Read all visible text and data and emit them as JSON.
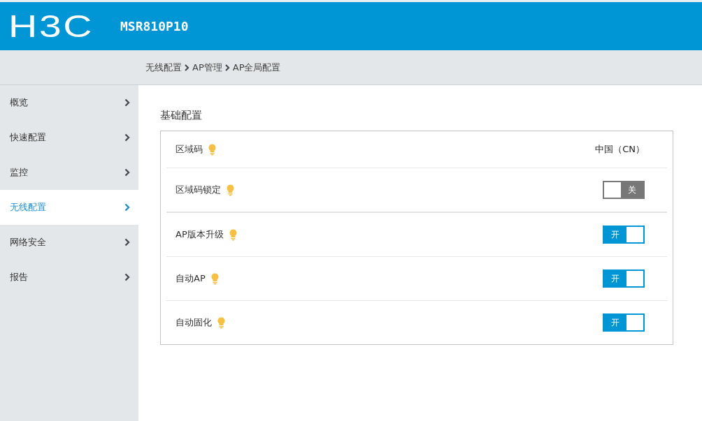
{
  "header": {
    "logo": "H3C",
    "model": "MSR810P10"
  },
  "breadcrumb": [
    "无线配置",
    "AP管理",
    "AP全局配置"
  ],
  "sidebar": {
    "items": [
      {
        "label": "概览",
        "selected": false
      },
      {
        "label": "快速配置",
        "selected": false
      },
      {
        "label": "监控",
        "selected": false
      },
      {
        "label": "无线配置",
        "selected": true
      },
      {
        "label": "网络安全",
        "selected": false
      },
      {
        "label": "报告",
        "selected": false
      }
    ]
  },
  "section": {
    "title": "基础配置",
    "rows": [
      {
        "kind": "value",
        "label": "区域码",
        "value": "中国（CN）"
      },
      {
        "kind": "toggle",
        "label": "区域码锁定",
        "on": false,
        "toggle_label": "关"
      },
      {
        "kind": "toggle",
        "label": "AP版本升级",
        "on": true,
        "toggle_label": "开"
      },
      {
        "kind": "toggle",
        "label": "自动AP",
        "on": true,
        "toggle_label": "开"
      },
      {
        "kind": "toggle",
        "label": "自动固化",
        "on": true,
        "toggle_label": "开"
      }
    ]
  }
}
